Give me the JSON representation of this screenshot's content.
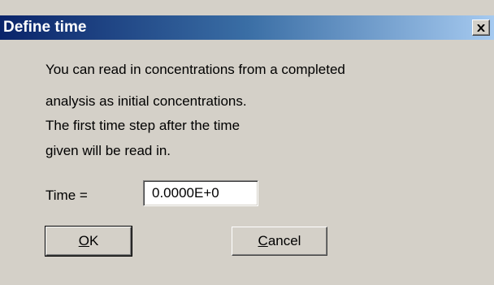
{
  "window": {
    "title": "Define time"
  },
  "message": {
    "lines": [
      "You can read in concentrations from a completed",
      "analysis as initial concentrations.",
      "The first time step after the time",
      "given will be read in."
    ]
  },
  "time_field": {
    "label": "Time =",
    "value": "0.0000E+0"
  },
  "buttons": {
    "ok": {
      "mnemonic": "O",
      "rest": "K"
    },
    "cancel": {
      "mnemonic": "C",
      "rest": "ancel"
    }
  },
  "icons": {
    "close": "close-icon"
  },
  "colors": {
    "dialog_bg": "#d4d0c8",
    "titlebar_start": "#0a246a",
    "titlebar_end": "#a6caf0"
  }
}
